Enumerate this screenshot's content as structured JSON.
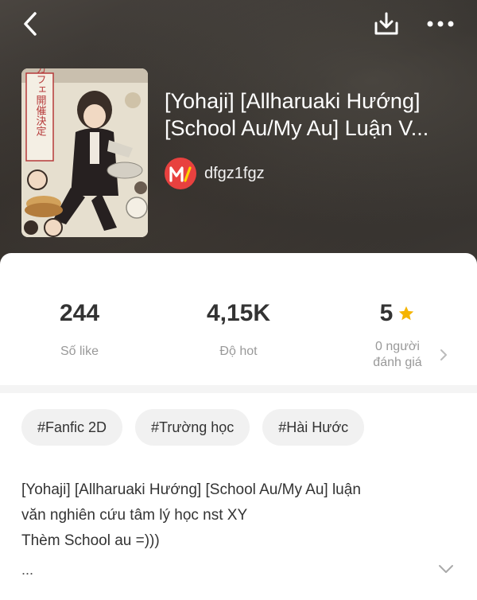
{
  "story": {
    "title_line1": "[Yohaji] [Allharuaki Hướng]",
    "title_line2": "[School Au/My Au] Luận V...",
    "author": "dfgz1fgz",
    "cover_text": "コラボカフェ開催決定"
  },
  "header": {
    "icons": [
      "back-icon",
      "download-icon",
      "more-icon"
    ]
  },
  "stats": {
    "likes_value": "244",
    "likes_label": "Số like",
    "hot_value": "4,15K",
    "hot_label": "Độ hot",
    "rating_value": "5",
    "rating_label_line1": "0 người",
    "rating_label_line2": "đánh giá"
  },
  "tags": [
    "#Fanfic 2D",
    "#Trường học",
    "#Hài Hước"
  ],
  "description": {
    "line1": "[Yohaji] [Allharuaki Hướng] [School Au/My Au] luận",
    "line2": "văn nghiên cứu tâm lý học nst XY",
    "line3": "Thèm School au =)))",
    "more": "..."
  },
  "colors": {
    "author_logo_bg": "#e8413f",
    "star": "#f5b400"
  }
}
